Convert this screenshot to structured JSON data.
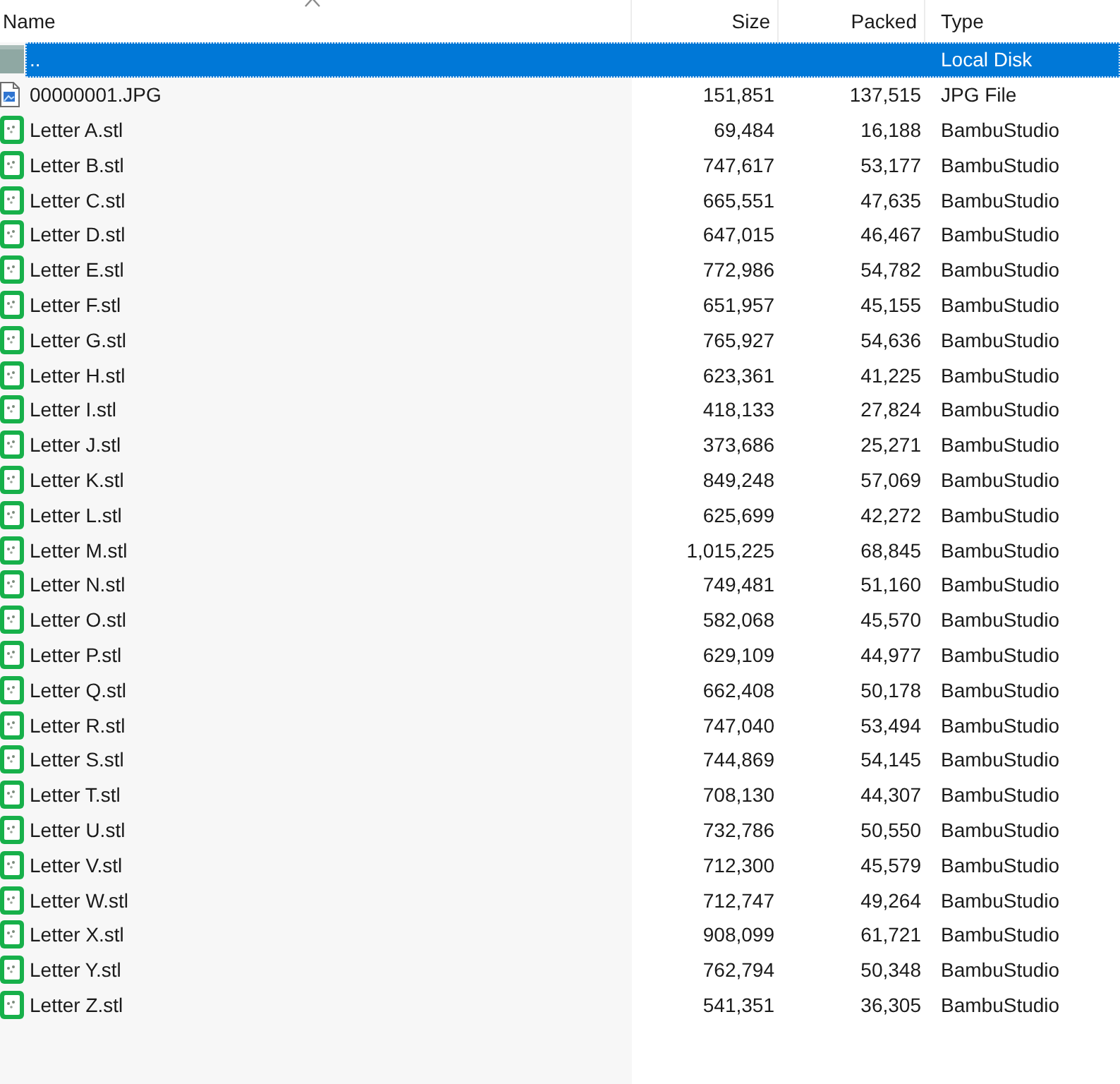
{
  "table": {
    "columns": [
      {
        "label": "Name",
        "sorted": true
      },
      {
        "label": "Size",
        "sorted": false
      },
      {
        "label": "Packed",
        "sorted": false
      },
      {
        "label": "Type",
        "sorted": false
      }
    ],
    "rows": [
      {
        "kind": "parent",
        "name": "..",
        "type": "Local Disk",
        "selected": true
      },
      {
        "kind": "image",
        "name": "00000001.JPG",
        "size": "151,851",
        "packed": "137,515",
        "type": "JPG File",
        "selected": false
      },
      {
        "kind": "model",
        "name": "Letter A.stl",
        "size": "69,484",
        "packed": "16,188",
        "type": "BambuStudio",
        "selected": false
      },
      {
        "kind": "model",
        "name": "Letter B.stl",
        "size": "747,617",
        "packed": "53,177",
        "type": "BambuStudio",
        "selected": false
      },
      {
        "kind": "model",
        "name": "Letter C.stl",
        "size": "665,551",
        "packed": "47,635",
        "type": "BambuStudio",
        "selected": false
      },
      {
        "kind": "model",
        "name": "Letter D.stl",
        "size": "647,015",
        "packed": "46,467",
        "type": "BambuStudio",
        "selected": false
      },
      {
        "kind": "model",
        "name": "Letter E.stl",
        "size": "772,986",
        "packed": "54,782",
        "type": "BambuStudio",
        "selected": false
      },
      {
        "kind": "model",
        "name": "Letter F.stl",
        "size": "651,957",
        "packed": "45,155",
        "type": "BambuStudio",
        "selected": false
      },
      {
        "kind": "model",
        "name": "Letter G.stl",
        "size": "765,927",
        "packed": "54,636",
        "type": "BambuStudio",
        "selected": false
      },
      {
        "kind": "model",
        "name": "Letter H.stl",
        "size": "623,361",
        "packed": "41,225",
        "type": "BambuStudio",
        "selected": false
      },
      {
        "kind": "model",
        "name": "Letter I.stl",
        "size": "418,133",
        "packed": "27,824",
        "type": "BambuStudio",
        "selected": false
      },
      {
        "kind": "model",
        "name": "Letter J.stl",
        "size": "373,686",
        "packed": "25,271",
        "type": "BambuStudio",
        "selected": false
      },
      {
        "kind": "model",
        "name": "Letter K.stl",
        "size": "849,248",
        "packed": "57,069",
        "type": "BambuStudio",
        "selected": false
      },
      {
        "kind": "model",
        "name": "Letter L.stl",
        "size": "625,699",
        "packed": "42,272",
        "type": "BambuStudio",
        "selected": false
      },
      {
        "kind": "model",
        "name": "Letter M.stl",
        "size": "1,015,225",
        "packed": "68,845",
        "type": "BambuStudio",
        "selected": false
      },
      {
        "kind": "model",
        "name": "Letter N.stl",
        "size": "749,481",
        "packed": "51,160",
        "type": "BambuStudio",
        "selected": false
      },
      {
        "kind": "model",
        "name": "Letter O.stl",
        "size": "582,068",
        "packed": "45,570",
        "type": "BambuStudio",
        "selected": false
      },
      {
        "kind": "model",
        "name": "Letter P.stl",
        "size": "629,109",
        "packed": "44,977",
        "type": "BambuStudio",
        "selected": false
      },
      {
        "kind": "model",
        "name": "Letter Q.stl",
        "size": "662,408",
        "packed": "50,178",
        "type": "BambuStudio",
        "selected": false
      },
      {
        "kind": "model",
        "name": "Letter R.stl",
        "size": "747,040",
        "packed": "53,494",
        "type": "BambuStudio",
        "selected": false
      },
      {
        "kind": "model",
        "name": "Letter S.stl",
        "size": "744,869",
        "packed": "54,145",
        "type": "BambuStudio",
        "selected": false
      },
      {
        "kind": "model",
        "name": "Letter T.stl",
        "size": "708,130",
        "packed": "44,307",
        "type": "BambuStudio",
        "selected": false
      },
      {
        "kind": "model",
        "name": "Letter U.stl",
        "size": "732,786",
        "packed": "50,550",
        "type": "BambuStudio",
        "selected": false
      },
      {
        "kind": "model",
        "name": "Letter V.stl",
        "size": "712,300",
        "packed": "45,579",
        "type": "BambuStudio",
        "selected": false
      },
      {
        "kind": "model",
        "name": "Letter W.stl",
        "size": "712,747",
        "packed": "49,264",
        "type": "BambuStudio",
        "selected": false
      },
      {
        "kind": "model",
        "name": "Letter X.stl",
        "size": "908,099",
        "packed": "61,721",
        "type": "BambuStudio",
        "selected": false
      },
      {
        "kind": "model",
        "name": "Letter Y.stl",
        "size": "762,794",
        "packed": "50,348",
        "type": "BambuStudio",
        "selected": false
      },
      {
        "kind": "model",
        "name": "Letter Z.stl",
        "size": "541,351",
        "packed": "36,305",
        "type": "BambuStudio",
        "selected": false
      }
    ]
  }
}
